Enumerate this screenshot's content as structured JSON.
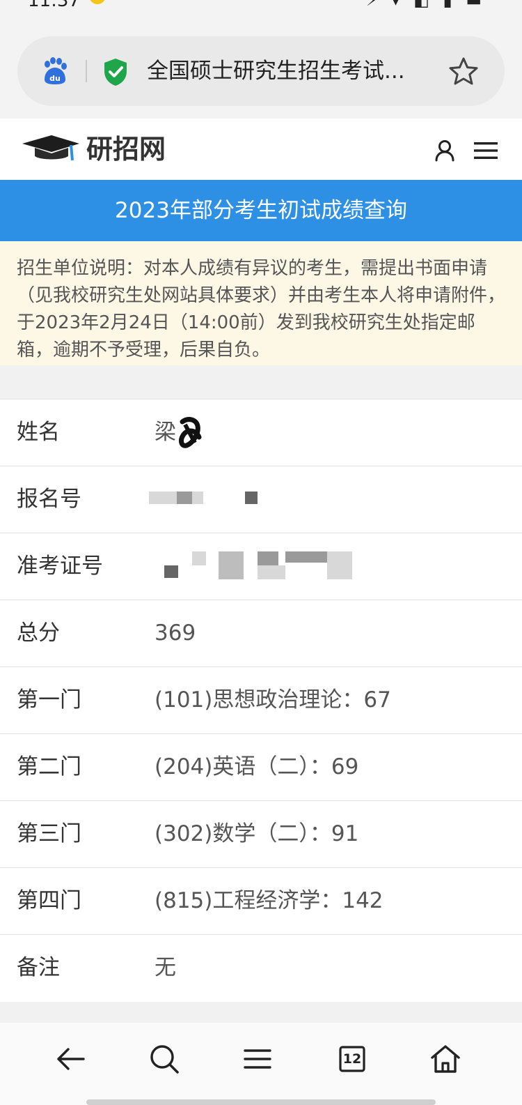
{
  "status_bar": {
    "time": "11:37",
    "icons": "⚡ ▾ ◧ ▮ ▬"
  },
  "browser": {
    "page_title": "全国硕士研究生招生考试...",
    "icons": {
      "search_engine": "baidu-paw-icon",
      "security": "green-shield-check-icon",
      "bookmark": "star-outline-icon"
    }
  },
  "site": {
    "name": "研招网",
    "icons": {
      "logo": "graduation-cap-icon",
      "account": "user-icon",
      "menu": "hamburger-menu-icon"
    }
  },
  "banner": {
    "title": "2023年部分考生初试成绩查询",
    "color": "#2e90e5"
  },
  "notice": {
    "text": "招生单位说明：对本人成绩有异议的考生，需提出书面申请（见我校研究生处网站具体要求）并由考生本人将申请附件，于2023年2月24日（14:00前）发到我校研究生处指定邮箱，逾期不予受理，后果自负。"
  },
  "results": [
    {
      "label": "姓名",
      "value": "梁"
    },
    {
      "label": "报名号",
      "value": ""
    },
    {
      "label": "准考证号",
      "value": ""
    },
    {
      "label": "总分",
      "value": "369"
    },
    {
      "label": "第一门",
      "value": "(101)思想政治理论：67"
    },
    {
      "label": "第二门",
      "value": "(204)英语（二）：69"
    },
    {
      "label": "第三门",
      "value": "(302)数学（二）：91"
    },
    {
      "label": "第四门",
      "value": "(815)工程经济学：142"
    },
    {
      "label": "备注",
      "value": "无"
    }
  ],
  "bottom_nav": {
    "tab_count": "12",
    "icons": [
      "back-arrow-icon",
      "search-icon",
      "menu-icon",
      "tabs-icon",
      "home-icon"
    ]
  }
}
